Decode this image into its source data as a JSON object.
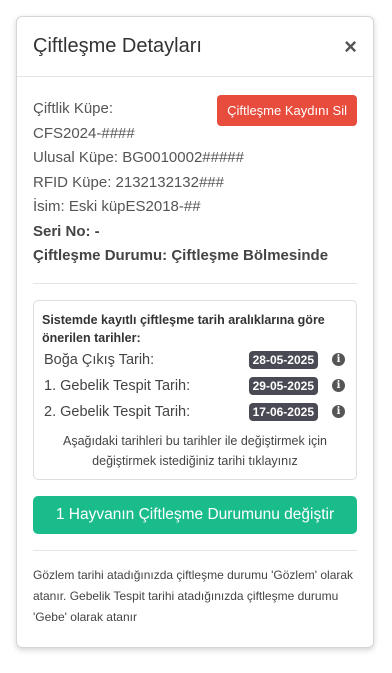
{
  "modal": {
    "title": "Çiftleşme Detayları",
    "close_glyph": "×"
  },
  "details": {
    "ciftlik_kupe": "Çiftlik Küpe: CFS2024-####",
    "ulusal_kupe": "Ulusal Küpe: BG0010002#####",
    "rfid_kupe": "RFID Küpe: 2132132132###",
    "isim": "İsim: Eski küpES2018-##",
    "seri_no": "Seri No: -",
    "durum": "Çiftleşme Durumu: Çiftleşme Bölmesinde"
  },
  "delete_button": "Çiftleşme Kaydını Sil",
  "suggestions": {
    "title": "Sistemde kayıtlı çiftleşme tarih aralıklarına göre önerilen tarihler:",
    "rows": [
      {
        "label": "Boğa Çıkış Tarih:",
        "date": "28-05-2025"
      },
      {
        "label": "1. Gebelik Tespit Tarih:",
        "date": "29-05-2025"
      },
      {
        "label": "2. Gebelik Tespit Tarih:",
        "date": "17-06-2025"
      }
    ],
    "note": "Aşağıdaki tarihleri bu tarihler ile değiştirmek için değiştirmek istediğiniz tarihi tıklayınız"
  },
  "main_button": "1 Hayvanın Çiftleşme Durumunu değiştir",
  "footer_note": "Gözlem tarihi atadığınızda çiftleşme durumu 'Gözlem' olarak atanır. Gebelik Tespit tarihi atadığınızda çiftleşme durumu 'Gebe' olarak atanır",
  "colors": {
    "danger": "#e74c3c",
    "success": "#1abc8c",
    "badge": "#4a4a55"
  },
  "icons": {
    "info": "info-circle-icon",
    "close": "close-icon"
  }
}
